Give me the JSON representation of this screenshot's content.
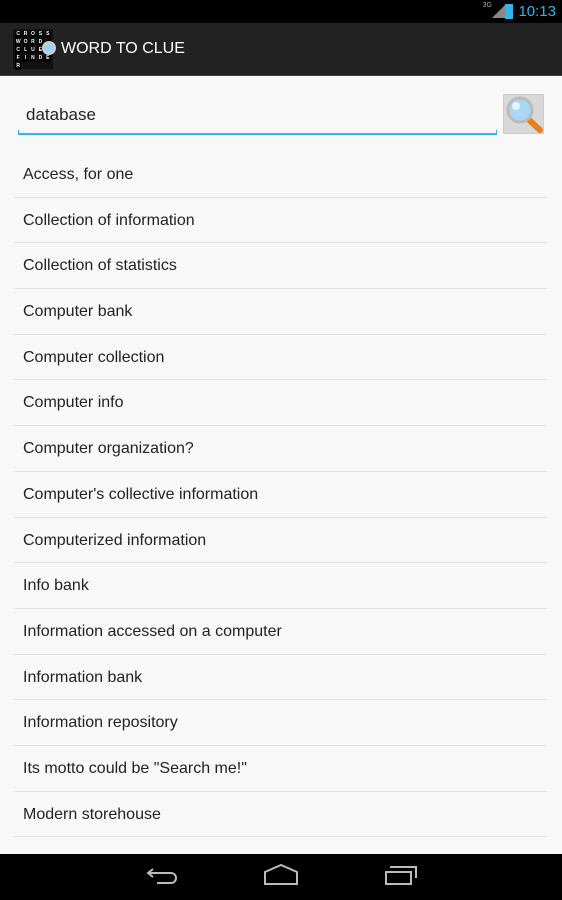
{
  "status_bar": {
    "network": "3G",
    "time": "10:13",
    "accent": "#33b5e5"
  },
  "action_bar": {
    "title": "WORD TO CLUE",
    "logo_letters": [
      "C",
      "R",
      "O",
      "S",
      "S",
      "W",
      "O",
      "R",
      "D",
      "",
      "C",
      "L",
      "U",
      "E",
      "",
      "F",
      "I",
      "N",
      "D",
      "E",
      "R"
    ]
  },
  "search": {
    "value": "database",
    "button_icon": "magnifier-icon"
  },
  "results": [
    "Access, for one",
    "Collection of information",
    "Collection of statistics",
    "Computer bank",
    "Computer collection",
    "Computer info",
    "Computer organization?",
    "Computer's collective information",
    "Computerized information",
    "Info bank",
    "Information accessed on a computer",
    "Information bank",
    "Information repository",
    "Its motto could be \"Search me!\"",
    "Modern storehouse"
  ],
  "nav_bar": {
    "icons": [
      "back-icon",
      "home-icon",
      "recent-apps-icon"
    ]
  }
}
